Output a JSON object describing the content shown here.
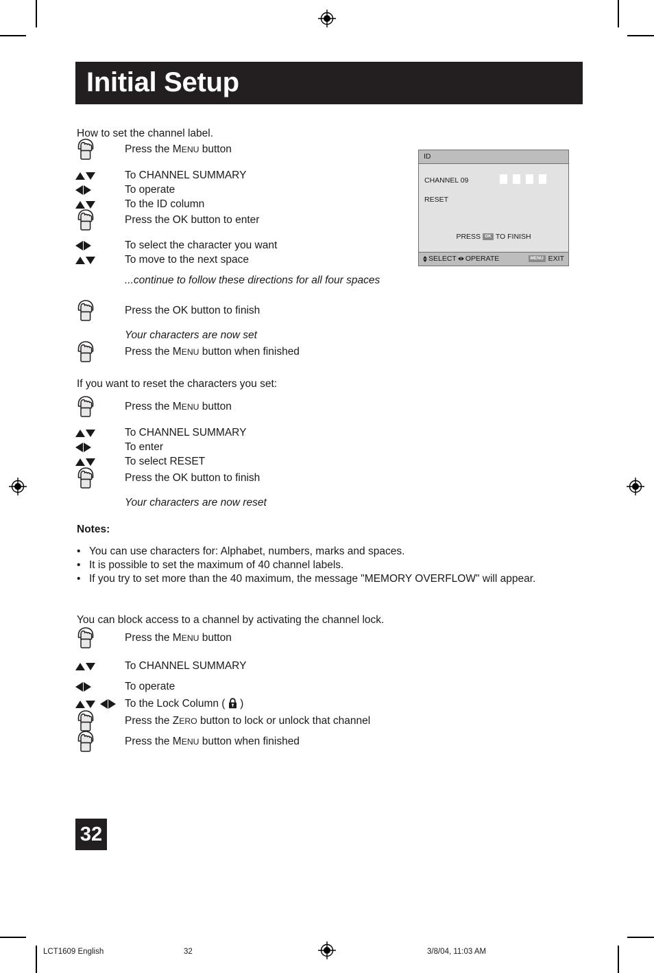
{
  "header": {
    "title": "Initial Setup"
  },
  "intro": {
    "line1": "How to set the channel label."
  },
  "steps_label": [
    {
      "cue": "hand",
      "text_pre": "Press the ",
      "sc_first": "M",
      "sc_rest": "ENU",
      "text_post": " button"
    },
    {
      "cue": "updown",
      "text": "To CHANNEL SUMMARY"
    },
    {
      "cue": "leftright",
      "text": "To operate"
    },
    {
      "cue": "updown",
      "text": "To the ID column"
    },
    {
      "cue": "hand",
      "text": "Press the OK button to enter"
    },
    {
      "cue": "leftright",
      "text": "To select the character you want"
    },
    {
      "cue": "updown",
      "text": "To move to the next space"
    },
    {
      "cue": "none",
      "italic": true,
      "text": "...continue to follow these directions for all four spaces"
    },
    {
      "cue": "hand",
      "text": "Press the OK button to finish"
    },
    {
      "cue": "none",
      "italic": true,
      "text": "Your characters are now set"
    },
    {
      "cue": "hand",
      "text_pre": "Press the ",
      "sc_first": "M",
      "sc_rest": "ENU",
      "text_post": " button when finished"
    }
  ],
  "reset_section": {
    "intro": "If you want to reset the characters you set:",
    "steps": [
      {
        "cue": "hand",
        "text_pre": "Press the ",
        "sc_first": "M",
        "sc_rest": "ENU",
        "text_post": " button"
      },
      {
        "cue": "updown",
        "text": "To CHANNEL SUMMARY"
      },
      {
        "cue": "leftright",
        "text": "To enter"
      },
      {
        "cue": "updown",
        "text": "To select RESET"
      },
      {
        "cue": "hand",
        "text": "Press the OK button to finish"
      },
      {
        "cue": "none",
        "italic": true,
        "text": "Your characters are now reset"
      }
    ]
  },
  "notes": {
    "heading": "Notes:",
    "bullet_glyph": "•",
    "items": [
      "You can use characters for: Alphabet, numbers, marks and spaces.",
      "It is possible to set the maximum of 40 channel labels.",
      "If you try to set more than the 40 maximum, the message \"MEMORY OVERFLOW\" will appear."
    ]
  },
  "lock_section": {
    "intro": "You can block access to a channel by activating the channel lock.",
    "steps": [
      {
        "cue": "hand",
        "text_pre": "Press the ",
        "sc_first": "M",
        "sc_rest": "ENU",
        "text_post": " button"
      },
      {
        "cue": "updown",
        "text": "To CHANNEL SUMMARY"
      },
      {
        "cue": "leftright",
        "text": "To operate"
      },
      {
        "cue": "updown-leftright",
        "text_pre": "To the Lock Column ( ",
        "lock": true,
        "text_post": " )"
      },
      {
        "cue": "hand",
        "text_pre": "Press the ",
        "sc_first": "Z",
        "sc_rest": "ERO",
        "text_post": " button to lock or unlock that channel"
      },
      {
        "cue": "hand",
        "text_pre": "Press the ",
        "sc_first": "M",
        "sc_rest": "ENU",
        "text_post": " button when finished"
      }
    ]
  },
  "osd": {
    "header_label": "ID",
    "channel_label": "CHANNEL 09",
    "char_boxes": [
      "",
      "",
      "",
      ""
    ],
    "reset_label": "RESET",
    "press_pre": "PRESS",
    "press_key": "OK",
    "press_post": "TO FINISH",
    "footer_select": "SELECT",
    "footer_operate": "OPERATE",
    "footer_menu_key": "MENU",
    "footer_exit": "EXIT",
    "colors": {
      "header_bg": "#bdbdbd",
      "body_bg": "#e2e2e2",
      "border": "#6e6e6e",
      "box_fill": "#ffffff",
      "key_badge": "#8a8a8a"
    }
  },
  "page_number": "32",
  "footer": {
    "doc_code": "LCT1609 English",
    "page": "32",
    "timestamp": "3/8/04, 11:03 AM"
  }
}
